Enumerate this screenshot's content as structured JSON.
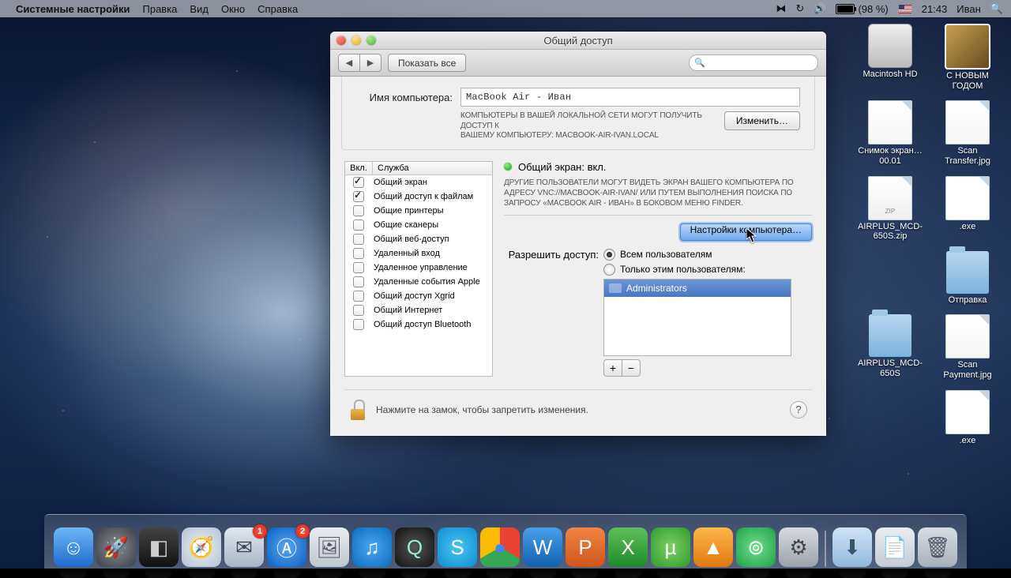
{
  "menubar": {
    "app": "Системные настройки",
    "items": [
      "Правка",
      "Вид",
      "Окно",
      "Справка"
    ],
    "battery": "(98 %)",
    "clock": "21:43",
    "user": "Иван"
  },
  "desktop_icons": [
    [
      {
        "name": "С НОВЫМ ГОДОМ",
        "kind": "img"
      },
      {
        "name": "Macintosh HD",
        "kind": "hdd"
      }
    ],
    [
      {
        "name": "Scan Transfer.jpg",
        "kind": "jpg"
      },
      {
        "name": "Снимок экран…00.01",
        "kind": "jpg"
      }
    ],
    [
      {
        "name": ".exe",
        "kind": "file"
      },
      {
        "name": "AIRPLUS_MCD-650S.zip",
        "kind": "zip"
      }
    ],
    [
      {
        "name": "Отправка",
        "kind": "folder"
      },
      {
        "name": "",
        "kind": "spacer"
      }
    ],
    [
      {
        "name": "Scan Payment.jpg",
        "kind": "jpg"
      },
      {
        "name": "AIRPLUS_MCD-650S",
        "kind": "folder"
      }
    ],
    [
      {
        "name": ".exe",
        "kind": "file"
      },
      {
        "name": "",
        "kind": "spacer"
      }
    ]
  ],
  "window": {
    "title": "Общий доступ",
    "show_all": "Показать все",
    "name_label": "Имя компьютера:",
    "name_value": "MacBook Air - Иван",
    "name_hint1": "Компьютеры в Вашей локальной сети могут получить доступ к",
    "name_hint2": "Вашему компьютеру: MacBook-Air-Ivan.local",
    "edit_btn": "Изменить…",
    "svc_head_on": "Вкл.",
    "svc_head_name": "Служба",
    "services": [
      {
        "on": true,
        "name": "Общий экран"
      },
      {
        "on": true,
        "name": "Общий доступ к файлам"
      },
      {
        "on": false,
        "name": "Общие принтеры"
      },
      {
        "on": false,
        "name": "Общие сканеры"
      },
      {
        "on": false,
        "name": "Общий веб-доступ"
      },
      {
        "on": false,
        "name": "Удаленный вход"
      },
      {
        "on": false,
        "name": "Удаленное управление"
      },
      {
        "on": false,
        "name": "Удаленные события Apple"
      },
      {
        "on": false,
        "name": "Общий доступ Xgrid"
      },
      {
        "on": false,
        "name": "Общий Интернет"
      },
      {
        "on": false,
        "name": "Общий доступ Bluetooth"
      }
    ],
    "status_title": "Общий экран: вкл.",
    "status_desc": "Другие пользователи могут видеть экран Вашего компьютера по адресу vnc://MacBook-Air-Ivan/ или путем выполнения поиска по запросу «MacBook Air - Иван» в боковом меню Finder.",
    "computer_settings_btn": "Настройки компьютера…",
    "allow_label": "Разрешить доступ:",
    "allow_all": "Всем пользователям",
    "allow_only": "Только этим пользователям:",
    "admin_group": "Administrators",
    "lock_hint": "Нажмите на замок, чтобы запретить изменения."
  },
  "dock": {
    "badge_appstore": "2",
    "items": [
      {
        "id": "finder",
        "bg": "linear-gradient(#6fb7f4,#1f6bd0)",
        "glyph": "☺",
        "fg": "#fff"
      },
      {
        "id": "launchpad",
        "bg": "radial-gradient(circle at 50% 50%,#8a8f96,#3a3f46)",
        "glyph": "🚀",
        "fg": "#fff"
      },
      {
        "id": "mission",
        "bg": "linear-gradient(#444,#111)",
        "glyph": "◧",
        "fg": "#ccc"
      },
      {
        "id": "safari",
        "bg": "radial-gradient(#e9eef4,#b6c4d4)",
        "glyph": "🧭",
        "fg": "#2860a6"
      },
      {
        "id": "mail",
        "bg": "linear-gradient(#dfe6ee,#a9b6c6)",
        "glyph": "✉",
        "fg": "#3b4250",
        "badge": "1"
      },
      {
        "id": "appstore",
        "bg": "radial-gradient(#5aa7f2,#0a5fbe)",
        "glyph": "Ⓐ",
        "fg": "#fff",
        "badge": "2"
      },
      {
        "id": "preview",
        "bg": "linear-gradient(#e8ecef,#bfc7cf)",
        "glyph": "🖼",
        "fg": "#556"
      },
      {
        "id": "itunes",
        "bg": "radial-gradient(#4aa7f2,#0a6cc0)",
        "glyph": "♫",
        "fg": "#fff"
      },
      {
        "id": "quicktime",
        "bg": "radial-gradient(#555,#111)",
        "glyph": "Q",
        "fg": "#9ec"
      },
      {
        "id": "skype",
        "bg": "radial-gradient(#49c3f2,#0f8dd0)",
        "glyph": "S",
        "fg": "#fff"
      },
      {
        "id": "chrome",
        "bg": "conic-gradient(#ea4335 0 120deg,#34a853 0 240deg,#fbbc05 0)",
        "glyph": "●",
        "fg": "#4285f4"
      },
      {
        "id": "word",
        "bg": "linear-gradient(#4aa0e8,#1360b0)",
        "glyph": "W",
        "fg": "#fff"
      },
      {
        "id": "powerpoint",
        "bg": "linear-gradient(#f28444,#d0551a)",
        "glyph": "P",
        "fg": "#fff"
      },
      {
        "id": "excel",
        "bg": "linear-gradient(#5fbf5a,#1f8a2a)",
        "glyph": "X",
        "fg": "#fff"
      },
      {
        "id": "utorrent",
        "bg": "radial-gradient(#7ed063,#2f9a2f)",
        "glyph": "µ",
        "fg": "#fff"
      },
      {
        "id": "vlc",
        "bg": "linear-gradient(#ffb64a,#e07a10)",
        "glyph": "▲",
        "fg": "#fff"
      },
      {
        "id": "airport",
        "bg": "radial-gradient(#6de08a,#1fa048)",
        "glyph": "⊚",
        "fg": "#fff"
      },
      {
        "id": "sysprefs",
        "bg": "linear-gradient(#d7dbe0,#9ba2ab)",
        "glyph": "⚙",
        "fg": "#444"
      }
    ],
    "right": [
      {
        "id": "downloads",
        "bg": "linear-gradient(#cfe3f4,#8fb9de)",
        "glyph": "⬇",
        "fg": "#356"
      },
      {
        "id": "stack",
        "bg": "linear-gradient(#e9edf1,#c4ccd4)",
        "glyph": "📄",
        "fg": "#667"
      },
      {
        "id": "trash",
        "bg": "linear-gradient(#d7dde3,#a8b0b9)",
        "glyph": "🗑",
        "fg": "#556"
      }
    ]
  }
}
